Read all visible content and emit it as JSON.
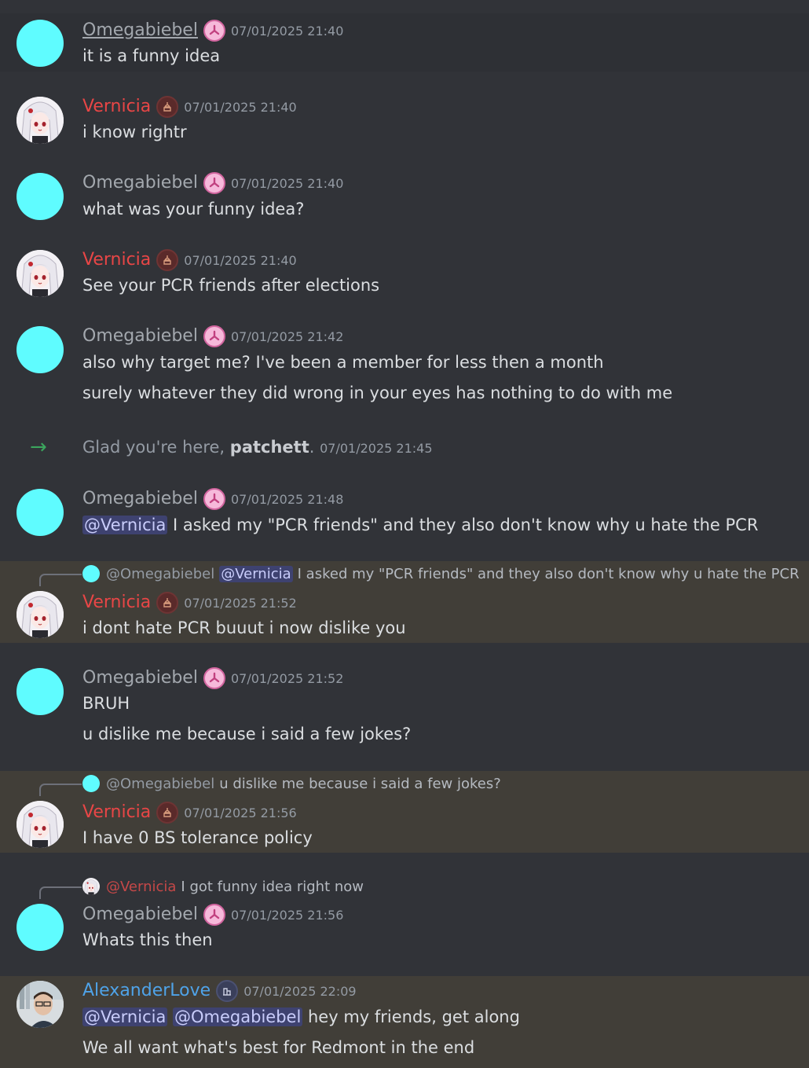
{
  "messages": [
    {
      "author": "Omegabiebel",
      "timestamp": "07/01/2025 21:40",
      "lines": [
        "it is a funny idea"
      ]
    },
    {
      "author": "Vernicia",
      "timestamp": "07/01/2025 21:40",
      "lines": [
        "i know rightr"
      ]
    },
    {
      "author": "Omegabiebel",
      "timestamp": "07/01/2025 21:40",
      "lines": [
        "what was your funny idea?"
      ]
    },
    {
      "author": "Vernicia",
      "timestamp": "07/01/2025 21:40",
      "lines": [
        "See your PCR friends after elections"
      ]
    },
    {
      "author": "Omegabiebel",
      "timestamp": "07/01/2025 21:42",
      "lines": [
        "also why target me? I've been a member for less then a month",
        "surely whatever they did wrong in your eyes has nothing to do with me"
      ]
    },
    {
      "author": "Omegabiebel",
      "timestamp": "07/01/2025 21:48",
      "mention": "@Vernicia",
      "lines": [
        "I asked my \"PCR friends\" and they also don't know why u hate the PCR"
      ]
    },
    {
      "author": "Vernicia",
      "timestamp": "07/01/2025 21:52",
      "reply": {
        "name": "@Omegabiebel",
        "mention": "@Vernicia",
        "text": "I asked my \"PCR friends\" and they also don't know why u hate the PCR"
      },
      "lines": [
        "i dont hate PCR buuut i now dislike you"
      ]
    },
    {
      "author": "Omegabiebel",
      "timestamp": "07/01/2025 21:52",
      "lines": [
        "BRUH",
        "u dislike me because i said a few jokes?"
      ]
    },
    {
      "author": "Vernicia",
      "timestamp": "07/01/2025 21:56",
      "reply": {
        "name": "@Omegabiebel",
        "text": "u dislike me because i said a few jokes?"
      },
      "lines": [
        "I have 0 BS tolerance policy"
      ]
    },
    {
      "author": "Omegabiebel",
      "timestamp": "07/01/2025 21:56",
      "reply": {
        "name": "@Vernicia",
        "text": "I got funny idea right now"
      },
      "lines": [
        "Whats this then"
      ]
    },
    {
      "author": "AlexanderLove",
      "timestamp": "07/01/2025 22:09",
      "mentions": [
        "@Vernicia",
        "@Omegabiebel"
      ],
      "lines": [
        "hey my friends, get along",
        "We all want what's best for Redmont in the end"
      ]
    }
  ],
  "system": {
    "prefix": "Glad you're here, ",
    "user": "patchett",
    "suffix": ".",
    "timestamp": "07/01/2025 21:45"
  },
  "colors": {
    "background": "#313338",
    "highlight": "#413e38",
    "omega": "#a3a8ae",
    "vernicia": "#e84646",
    "alexander": "#4fa3e8",
    "mention_bg": "#3e4270",
    "join_arrow": "#3ba55d"
  },
  "icons": {
    "join": "arrow-right-icon",
    "omega_badge": "pink-role-icon",
    "vernicia_badge": "capitol-role-icon",
    "alexander_badge": "building-role-icon"
  }
}
